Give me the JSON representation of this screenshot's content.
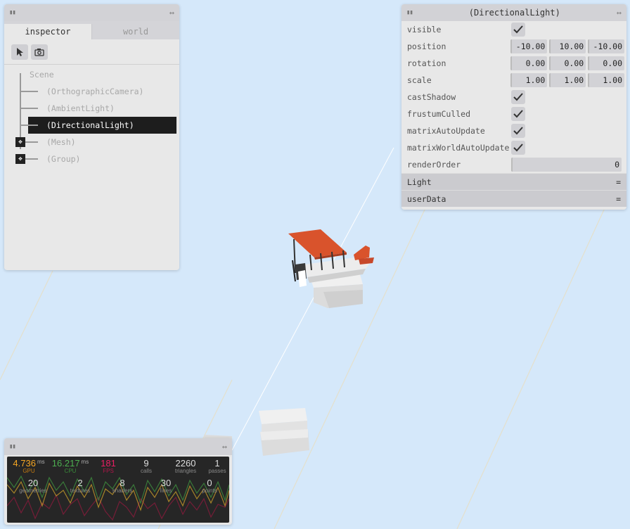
{
  "inspector": {
    "tabs": [
      {
        "label": "inspector",
        "active": true
      },
      {
        "label": "world",
        "active": false
      }
    ],
    "tools": [
      "pointer-icon",
      "camera-icon"
    ],
    "tree": {
      "root": "Scene",
      "items": [
        {
          "label": "(OrthographicCamera)",
          "selected": false,
          "expandable": false
        },
        {
          "label": "(AmbientLight)",
          "selected": false,
          "expandable": false
        },
        {
          "label": "(DirectionalLight)",
          "selected": true,
          "expandable": false
        },
        {
          "label": "(Mesh)",
          "selected": false,
          "expandable": true
        },
        {
          "label": "(Group)",
          "selected": false,
          "expandable": true
        }
      ]
    }
  },
  "properties": {
    "title": "(DirectionalLight)",
    "visible": {
      "label": "visible",
      "checked": true
    },
    "position": {
      "label": "position",
      "x": "-10.00",
      "y": "10.00",
      "z": "-10.00"
    },
    "rotation": {
      "label": "rotation",
      "x": "0.00",
      "y": "0.00",
      "z": "0.00"
    },
    "scale": {
      "label": "scale",
      "x": "1.00",
      "y": "1.00",
      "z": "1.00"
    },
    "castShadow": {
      "label": "castShadow",
      "checked": true
    },
    "frustumCulled": {
      "label": "frustumCulled",
      "checked": true
    },
    "matrixAutoUpdate": {
      "label": "matrixAutoUpdate",
      "checked": true
    },
    "matrixWorldAutoUpdate": {
      "label": "matrixWorldAutoUpdate",
      "checked": true
    },
    "renderOrder": {
      "label": "renderOrder",
      "value": "0"
    },
    "sections": [
      {
        "label": "Light"
      },
      {
        "label": "userData"
      }
    ]
  },
  "stats": {
    "gpu": {
      "value": "4.736",
      "unit": "ms",
      "label": "GPU",
      "color": "#f5a623"
    },
    "cpu": {
      "value": "16.217",
      "unit": "ms",
      "label": "CPU",
      "color": "#4caf50"
    },
    "fps": {
      "value": "181",
      "label": "FPS",
      "color": "#e91e63"
    },
    "calls": {
      "value": "9",
      "label": "calls"
    },
    "triangles": {
      "value": "2260",
      "label": "triangles"
    },
    "passes": {
      "value": "1",
      "label": "passes"
    },
    "geometries": {
      "value": "20",
      "label": "geometries"
    },
    "textures": {
      "value": "2",
      "label": "textures"
    },
    "shaders": {
      "value": "8",
      "label": "shaders"
    },
    "lines": {
      "value": "30",
      "label": "lines"
    },
    "points": {
      "value": "0",
      "label": "points"
    }
  },
  "colors": {
    "background": "#d5e8fa",
    "wing": "#d9532c",
    "body": "#e8e8e8",
    "cloud": "#e6e6e6"
  }
}
